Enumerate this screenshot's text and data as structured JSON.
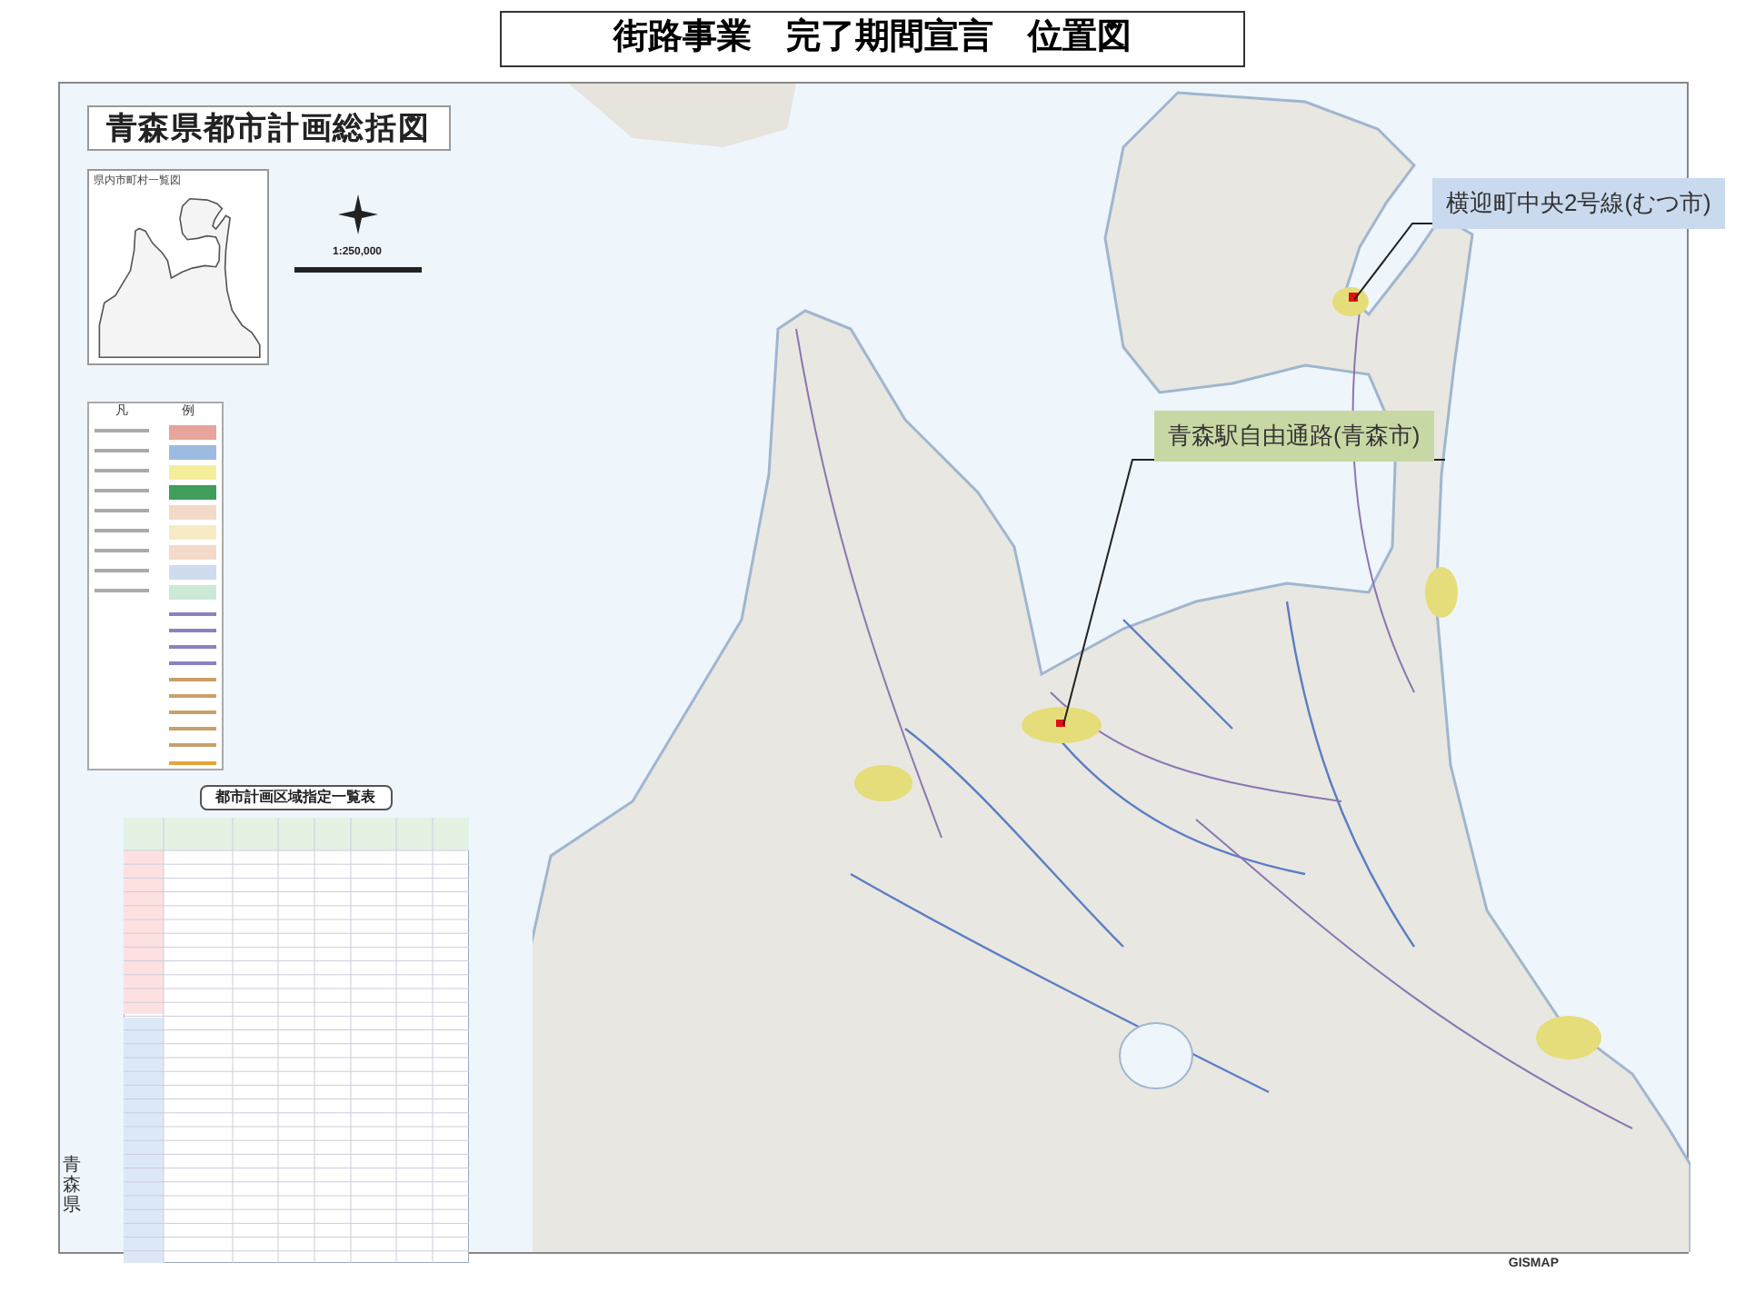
{
  "title": "街路事業　完了期間宣言　位置図",
  "map_title": "青森県都市計画総括図",
  "inset": {
    "title": "県内市町村一覧図"
  },
  "scale": "1:250,000",
  "legend": {
    "header": [
      "凡",
      "例"
    ]
  },
  "table": {
    "title": "都市計画区域指定一覧表"
  },
  "callouts": [
    {
      "label": "横迎町中央2号線(むつ市)",
      "color": "#c9d9ee"
    },
    {
      "label": "青森駅自由通路(青森市)",
      "color": "#c8d8a4"
    }
  ],
  "side_label": "青森県",
  "logo": "GISMAP"
}
